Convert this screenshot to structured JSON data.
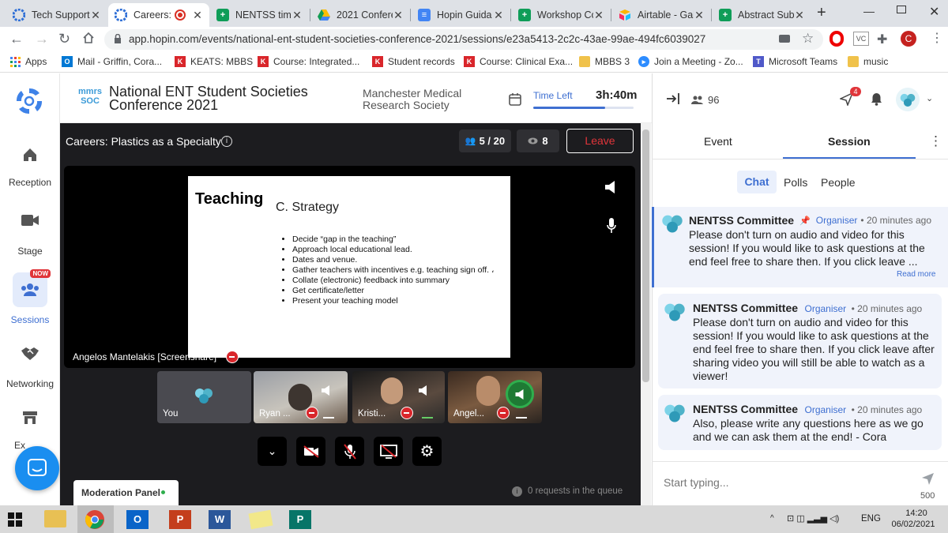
{
  "browser": {
    "tabs": [
      {
        "title": "Tech Support",
        "icon": "hopin-icon"
      },
      {
        "title": "Careers: |",
        "icon": "hopin-icon"
      },
      {
        "title": "NENTSS time",
        "icon": "sheets-icon"
      },
      {
        "title": "2021 Confere",
        "icon": "drive-icon"
      },
      {
        "title": "Hopin Guida",
        "icon": "docs-icon"
      },
      {
        "title": "Workshop Co",
        "icon": "sheets-icon"
      },
      {
        "title": "Airtable - Gal",
        "icon": "airtable-icon"
      },
      {
        "title": "Abstract Subr",
        "icon": "sheets-icon"
      }
    ],
    "url": "app.hopin.com/events/national-ent-student-societies-conference-2021/sessions/e23a5413-2c2c-43ae-99ae-494fc6039027",
    "profile_initial": "C",
    "vc_label": "VC",
    "bookmarks": [
      {
        "label": "Apps"
      },
      {
        "label": "Mail - Griffin, Cora..."
      },
      {
        "label": "KEATS: MBBS"
      },
      {
        "label": "Course: Integrated..."
      },
      {
        "label": "Student records"
      },
      {
        "label": "Course: Clinical Exa..."
      },
      {
        "label": "MBBS 3"
      },
      {
        "label": "Join a Meeting - Zo..."
      },
      {
        "label": "Microsoft Teams"
      },
      {
        "label": "music"
      }
    ]
  },
  "header": {
    "logo_text": "mmrs\nSOC",
    "event_title_line1": "National ENT Student Societies",
    "event_title_line2": "Conference 2021",
    "organizer_line1": "Manchester Medical",
    "organizer_line2": "Research Society",
    "time_left_label": "Time Left",
    "time_left_value": "3h:40m",
    "time_progress": 0.72,
    "attendees": "96",
    "notification_count": "4"
  },
  "nav": {
    "items": [
      {
        "label": "Reception"
      },
      {
        "label": "Stage"
      },
      {
        "label": "Sessions",
        "badge": "NOW"
      },
      {
        "label": "Networking"
      },
      {
        "label": "Ex"
      }
    ]
  },
  "session": {
    "title": "Careers: Plastics as a Specialty",
    "participants": "5 / 20",
    "viewers": "8",
    "leave_label": "Leave",
    "screenshare_name": "Angelos Mantelakis [Screenshare]",
    "slide": {
      "heading": "Teaching",
      "subheading": "C. Strategy",
      "bullets": [
        "Decide “gap in the teaching”",
        "Approach local educational lead.",
        "Dates and venue.",
        "Gather teachers with incentives e.g. teaching sign off. ،",
        "Collate (electronic) feedback into summary",
        "Get certificate/letter",
        "Present your teaching model"
      ]
    },
    "tiles": [
      {
        "name": "You"
      },
      {
        "name": "Ryan ..."
      },
      {
        "name": "Kristi..."
      },
      {
        "name": "Angel..."
      }
    ],
    "moderation_label": "Moderation Panel",
    "queue_text": "0 requests in the queue"
  },
  "chat": {
    "tabs": {
      "event": "Event",
      "session": "Session"
    },
    "subtabs": {
      "chat": "Chat",
      "polls": "Polls",
      "people": "People"
    },
    "messages": [
      {
        "author": "NENTSS Committee",
        "role": "Organiser",
        "time": "20 minutes ago",
        "text": "Please don't turn on audio and video for this session! If you would like to ask questions at the end feel free to share then. If you click leave ...",
        "read_more": "Read more"
      },
      {
        "author": "NENTSS Committee",
        "role": "Organiser",
        "time": "20 minutes ago",
        "text": "Please don't turn on audio and video for this session! If you would like to ask questions at the end feel free to share then. If you click leave after sharing video you will still be able to watch as a viewer!"
      },
      {
        "author": "NENTSS Committee",
        "role": "Organiser",
        "time": "20 minutes ago",
        "text": "Also, please write any questions here as we go and we can ask them at the end! - Cora"
      }
    ],
    "input_placeholder": "Start typing...",
    "char_limit": "500"
  },
  "taskbar": {
    "language": "ENG",
    "time": "14:20",
    "date": "06/02/2021"
  },
  "colors": {
    "accent": "#3e6fd1",
    "leave_red": "#e0353a",
    "stage_bg": "#1c1c1f"
  }
}
